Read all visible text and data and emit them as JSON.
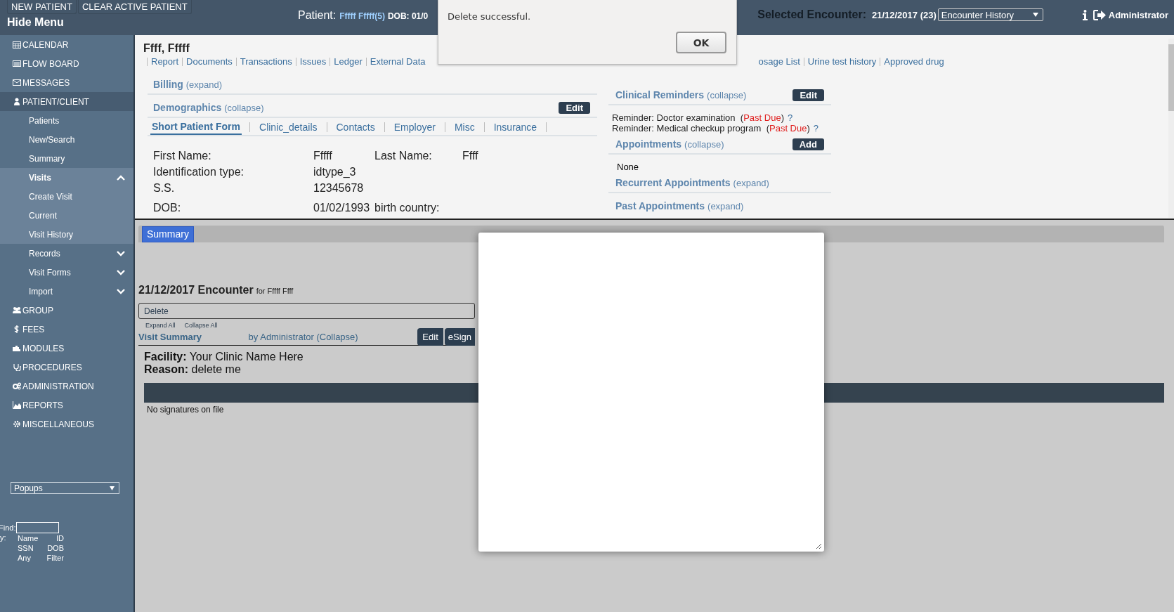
{
  "top_bar": {
    "buttons": [
      "NEW PATIENT",
      "CLEAR ACTIVE PATIENT"
    ],
    "hide_menu": "Hide Menu",
    "patient_label": "Patient:",
    "patient_name": "Fffff Fffff(5)",
    "patient_dob": "DOB: 01/0",
    "encounter_label": "Selected Encounter:",
    "encounter_value": "21/12/2017 (23)",
    "encounter_dropdown": "Encounter History",
    "user": "Administrator"
  },
  "sidebar": {
    "items": [
      {
        "label": "CALENDAR",
        "selected": false
      },
      {
        "label": "FLOW BOARD",
        "selected": false
      },
      {
        "label": "MESSAGES",
        "selected": false
      },
      {
        "label": "PATIENT/CLIENT",
        "selected": true,
        "children": [
          {
            "label": "Patients",
            "selected": false
          },
          {
            "label": "New/Search",
            "selected": false
          },
          {
            "label": "Summary",
            "selected": false
          },
          {
            "label": "Visits",
            "selected": true,
            "expanded": true,
            "children": [
              {
                "label": "Create Visit",
                "selected": false
              },
              {
                "label": "Current",
                "selected": false
              },
              {
                "label": "Visit History",
                "selected": false
              }
            ]
          },
          {
            "label": "Records",
            "selected": false,
            "expanded": false
          },
          {
            "label": "Visit Forms",
            "selected": false,
            "expanded": false
          },
          {
            "label": "Import",
            "selected": false,
            "expanded": false
          }
        ]
      },
      {
        "label": "GROUP",
        "selected": false
      },
      {
        "label": "FEES",
        "selected": false
      },
      {
        "label": "MODULES",
        "selected": false
      },
      {
        "label": "PROCEDURES",
        "selected": false
      },
      {
        "label": "ADMINISTRATION",
        "selected": false
      },
      {
        "label": "REPORTS",
        "selected": false
      },
      {
        "label": "MISCELLANEOUS",
        "selected": false
      }
    ],
    "popups": "Popups",
    "find_label": "Find:",
    "by_label": "y:",
    "find_options": [
      "Name",
      "ID",
      "SSN",
      "DOB",
      "Any",
      "Filter"
    ]
  },
  "patient_pane": {
    "name": "Ffff, Fffff",
    "links": [
      "Report",
      "Documents",
      "Transactions",
      "Issues",
      "Ledger",
      "External Data"
    ],
    "links_after_dialog": [
      "osage List",
      "Urine test history",
      "Approved drug"
    ],
    "billing": {
      "title": "Billing",
      "toggle": "(expand)"
    },
    "demographics": {
      "title": "Demographics",
      "toggle": "(collapse)",
      "button": "Edit",
      "tabs": [
        {
          "label": "Short Patient Form",
          "selected": true
        },
        {
          "label": "Clinic_details",
          "selected": false
        },
        {
          "label": "Contacts",
          "selected": false
        },
        {
          "label": "Employer",
          "selected": false
        },
        {
          "label": "Misc",
          "selected": false
        },
        {
          "label": "Insurance",
          "selected": false
        }
      ],
      "fields": [
        {
          "label": "First Name:",
          "value": "Fffff",
          "label2": "Last Name:",
          "value2": "Ffff"
        },
        {
          "label": "Identification type:",
          "value": "idtype_3"
        },
        {
          "label": "S.S.",
          "value": "12345678"
        },
        {
          "label": "DOB:",
          "value": "01/02/1993",
          "label2": "birth country:"
        }
      ]
    },
    "clinical_reminders": {
      "title": "Clinical Reminders",
      "toggle": "(collapse)",
      "button": "Edit",
      "reminders": [
        {
          "text": "Reminder: Doctor examination  (",
          "status": "Past Due",
          "close": ")",
          "help": "?"
        },
        {
          "text": "Reminder: Medical checkup program  (",
          "status": "Past Due",
          "close": ")",
          "help": "?"
        }
      ]
    },
    "appointments": {
      "title": "Appointments",
      "toggle": "(collapse)",
      "button": "Add",
      "content": "None"
    },
    "recurrent_appointments": {
      "title": "Recurrent Appointments",
      "toggle": "(expand)"
    },
    "past_appointments": {
      "title": "Past Appointments",
      "toggle": "(expand)"
    }
  },
  "encounter_pane": {
    "tabs": [
      {
        "label": "Summary",
        "selected": true
      }
    ],
    "title": "21/12/2017 Encounter",
    "title_for": "for Fffff Ffff",
    "delete": "Delete",
    "expand_all": "Expand All",
    "collapse_all": "Collapse All",
    "section": "Visit Summary",
    "section_by": "by Administrator (Collapse)",
    "buttons": [
      "Edit",
      "eSign"
    ],
    "facility_label": "Facility:",
    "facility": "Your Clinic Name Here",
    "reason_label": "Reason:",
    "reason": "delete me",
    "signatures": "No signatures on file"
  },
  "alert": {
    "message": "Delete successful.",
    "button": "OK"
  }
}
